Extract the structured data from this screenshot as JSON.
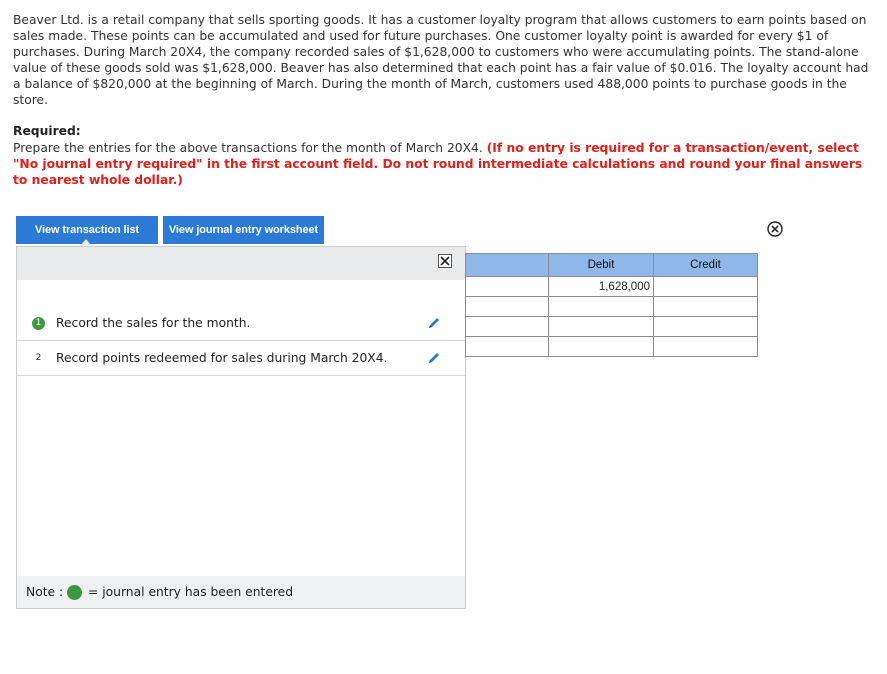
{
  "problem": {
    "text": "Beaver Ltd. is a retail company that sells sporting goods. It has a customer loyalty program that allows customers to earn points based on sales made. These points can be accumulated and used for future purchases. One customer loyalty point is awarded for every $1 of purchases. During March 20X4, the company recorded sales of $1,628,000 to customers who were accumulating points. The stand-alone value of these goods sold was $1,628,000. Beaver has also determined that each point has a fair value of $0.016. The loyalty account had a balance of $820,000 at the beginning of March. During the month of March, customers used 488,000 points to purchase goods in the store."
  },
  "required": {
    "label": "Required:",
    "text": "Prepare the entries for the above transactions for the month of March 20X4.",
    "instruction": "(If no entry is required for a transaction/event, select \"No journal entry required\" in the first account field. Do not round intermediate calculations and round your final answers to nearest whole dollar.)"
  },
  "buttons": {
    "view_transaction_list": "View transaction list",
    "view_journal_worksheet": "View journal entry worksheet"
  },
  "transactions": [
    {
      "number": "1",
      "label": "Record the sales for the month.",
      "entered": true
    },
    {
      "number": "2",
      "label": "Record points redeemed for sales during March 20X4.",
      "entered": false
    }
  ],
  "note": {
    "label": "Note :",
    "legend": "= journal entry has been entered"
  },
  "journal": {
    "headers": {
      "account": "",
      "debit": "Debit",
      "credit": "Credit"
    },
    "rows": [
      {
        "account": "",
        "debit": "1,628,000",
        "credit": ""
      },
      {
        "account": "",
        "debit": "",
        "credit": ""
      },
      {
        "account": "",
        "debit": "",
        "credit": ""
      },
      {
        "account": "",
        "debit": "",
        "credit": ""
      }
    ]
  },
  "colors": {
    "button_blue": "#2b7bd6",
    "instruction_red": "#e0201b",
    "entered_green": "#3b9a3e",
    "table_header_blue": "#8fb8e8"
  },
  "icons": {
    "close": "circle-x-icon",
    "panel_close": "close-icon",
    "edit": "pencil-icon"
  }
}
